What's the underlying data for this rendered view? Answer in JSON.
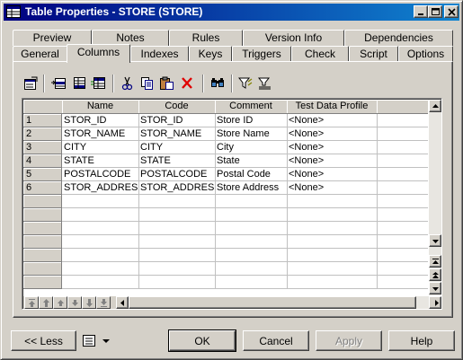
{
  "window": {
    "title": "Table Properties - STORE (STORE)"
  },
  "tabs_row1": [
    {
      "label": "Preview"
    },
    {
      "label": "Notes"
    },
    {
      "label": "Rules"
    },
    {
      "label": "Version Info"
    },
    {
      "label": "Dependencies"
    }
  ],
  "tabs_row2": [
    {
      "label": "General"
    },
    {
      "label": "Columns",
      "active": true
    },
    {
      "label": "Indexes"
    },
    {
      "label": "Keys"
    },
    {
      "label": "Triggers"
    },
    {
      "label": "Check"
    },
    {
      "label": "Script"
    },
    {
      "label": "Options"
    }
  ],
  "toolbar": [
    "properties-icon",
    "insert-row-icon",
    "add-row-icon",
    "add-columns-icon",
    "cut-icon",
    "copy-icon",
    "paste-icon",
    "delete-icon",
    "find-icon",
    "filter-icon",
    "clear-filter-icon"
  ],
  "grid": {
    "columns": [
      "Name",
      "Code",
      "Comment",
      "Test Data Profile"
    ],
    "rows": [
      {
        "num": "1",
        "cells": [
          "STOR_ID",
          "STOR_ID",
          "Store ID",
          "<None>"
        ]
      },
      {
        "num": "2",
        "cells": [
          "STOR_NAME",
          "STOR_NAME",
          "Store Name",
          "<None>"
        ]
      },
      {
        "num": "3",
        "cells": [
          "CITY",
          "CITY",
          "City",
          "<None>"
        ]
      },
      {
        "num": "4",
        "cells": [
          "STATE",
          "STATE",
          "State",
          "<None>"
        ]
      },
      {
        "num": "5",
        "cells": [
          "POSTALCODE",
          "POSTALCODE",
          "Postal Code",
          "<None>"
        ]
      },
      {
        "num": "6",
        "cells": [
          "STOR_ADDRESS",
          "STOR_ADDRESS",
          "Store Address",
          "<None>"
        ]
      }
    ],
    "empty_rows": 7
  },
  "buttons": {
    "less": "<< Less",
    "ok": "OK",
    "cancel": "Cancel",
    "apply": "Apply",
    "help": "Help"
  }
}
